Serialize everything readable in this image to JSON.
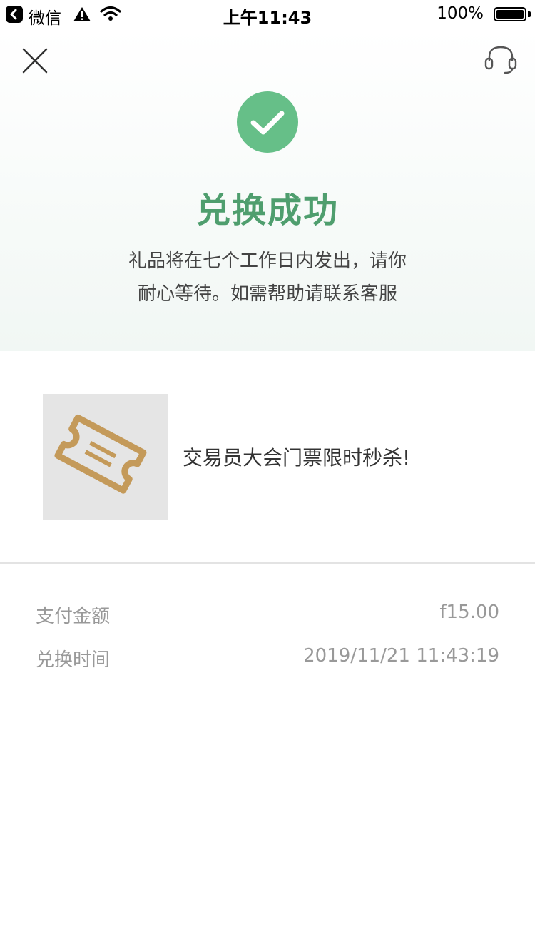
{
  "status_bar": {
    "back_app": "微信",
    "time": "上午11:43",
    "battery": "100%"
  },
  "hero": {
    "title": "兑换成功",
    "desc_line1": "礼品将在七个工作日内发出，请你",
    "desc_line2": "耐心等待。如需帮助请联系客服"
  },
  "product": {
    "name": "交易员大会门票限时秒杀!"
  },
  "details": {
    "pay_label": "支付金额",
    "pay_value": "f15.00",
    "time_label": "兑换时间",
    "time_value": "2019/11/21 11:43:19"
  },
  "colors": {
    "success_green": "#66bf88",
    "title_green": "#4f9e6e",
    "ticket_tan": "#c49a5a",
    "muted_text": "#999999"
  },
  "icons": {
    "close": "close-icon",
    "service": "headset-icon",
    "success": "check-icon",
    "ticket": "ticket-icon"
  }
}
